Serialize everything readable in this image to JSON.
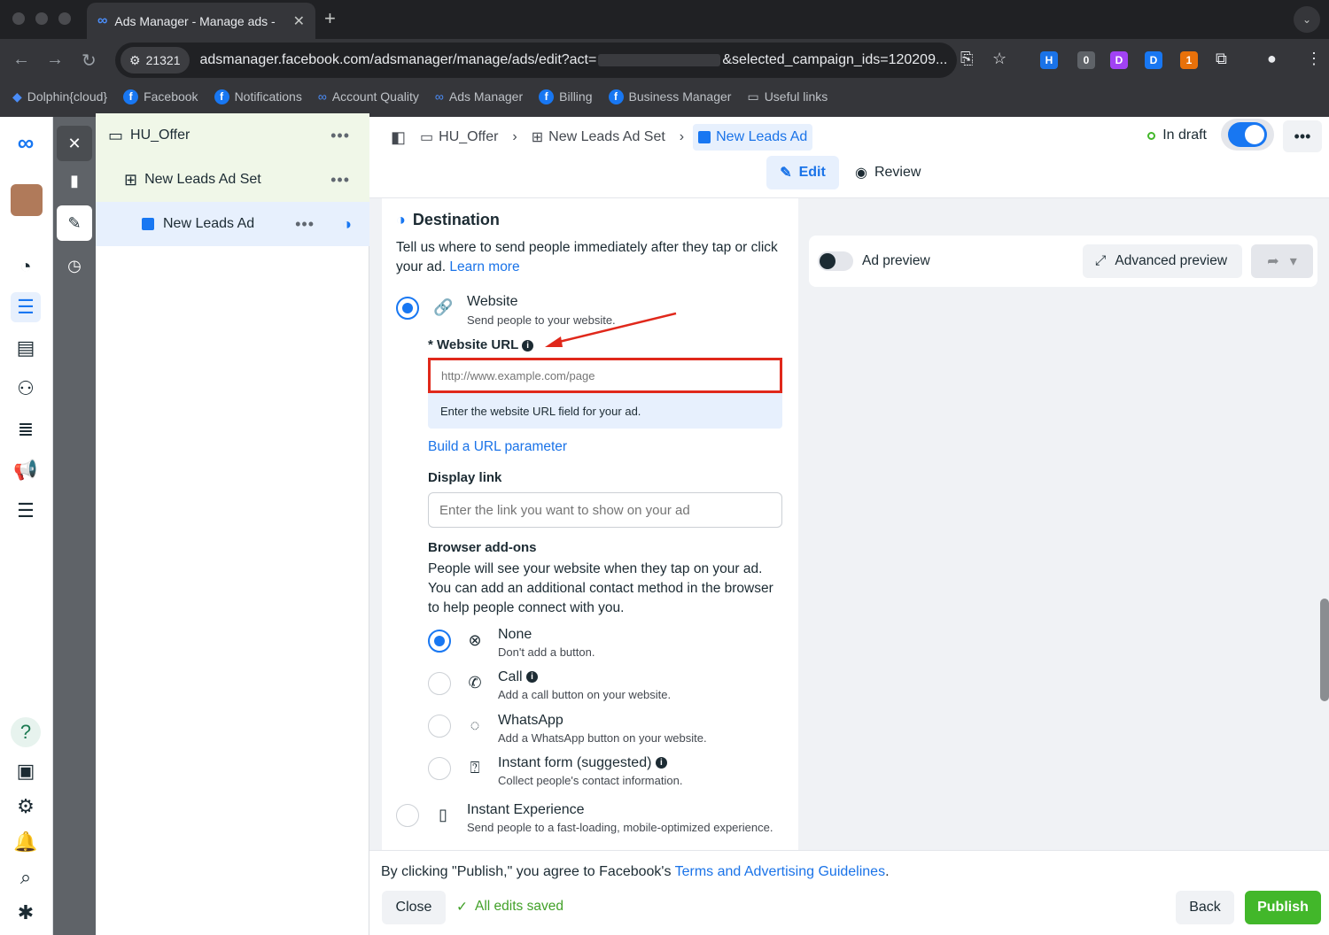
{
  "browser": {
    "tab_title": "Ads Manager - Manage ads -",
    "site_chip": "21321",
    "url_start": "adsmanager.facebook.com/adsmanager/manage/ads/edit?act=",
    "url_end": "&selected_campaign_ids=120209...",
    "ext_badge_1": "0",
    "ext_badge_2": "1",
    "bookmarks": [
      "Dolphin{cloud}",
      "Facebook",
      "Notifications",
      "Account Quality",
      "Ads Manager",
      "Billing",
      "Business Manager",
      "Useful links"
    ]
  },
  "tree": {
    "campaign": "HU_Offer",
    "adset": "New Leads Ad Set",
    "ad": "New Leads Ad",
    "more": "•••"
  },
  "breadcrumb": {
    "campaign": "HU_Offer",
    "adset": "New Leads Ad Set",
    "ad": "New Leads Ad"
  },
  "status": {
    "label": "In draft",
    "toggle_on": true
  },
  "tabs": {
    "edit": "Edit",
    "review": "Review"
  },
  "destination": {
    "heading": "Destination",
    "description": "Tell us where to send people immediately after they tap or click your ad.",
    "learn_more": "Learn more",
    "website_title": "Website",
    "website_sub": "Send people to your website.",
    "url_label": "* Website URL",
    "url_placeholder": "http://www.example.com/page",
    "url_hint": "Enter the website URL field for your ad.",
    "build_param": "Build a URL parameter",
    "display_link_label": "Display link",
    "display_link_placeholder": "Enter the link you want to show on your ad",
    "addons_heading": "Browser add-ons",
    "addons_desc": "People will see your website when they tap on your ad. You can add an additional contact method in the browser to help people connect with you.",
    "addons": [
      {
        "title": "None",
        "sub": "Don't add a button.",
        "selected": true
      },
      {
        "title": "Call",
        "sub": "Add a call button on your website.",
        "selected": false
      },
      {
        "title": "WhatsApp",
        "sub": "Add a WhatsApp button on your website.",
        "selected": false
      },
      {
        "title": "Instant form (suggested)",
        "sub": "Collect people's contact information.",
        "selected": false
      }
    ],
    "instant_title": "Instant Experience",
    "instant_sub": "Send people to a fast-loading, mobile-optimized experience."
  },
  "preview": {
    "ad_preview": "Ad preview",
    "advanced_preview": "Advanced preview"
  },
  "footer": {
    "terms_prefix": "By clicking \"Publish,\" you agree to Facebook's",
    "terms_link": "Terms and Advertising Guidelines",
    "terms_suffix": ".",
    "close": "Close",
    "saved": "All edits saved",
    "back": "Back",
    "publish": "Publish"
  },
  "colors": {
    "accent": "#1877f2",
    "publish": "#42b72a",
    "highlight_red": "#e0281b"
  }
}
